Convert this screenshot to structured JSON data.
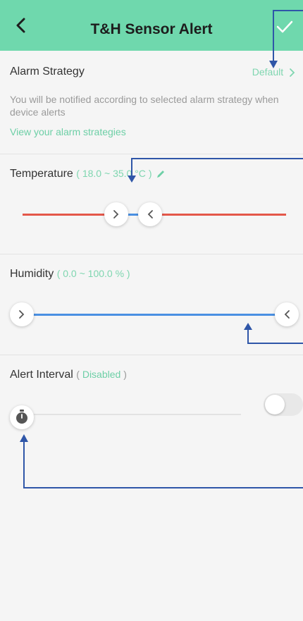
{
  "header": {
    "title": "T&H Sensor Alert",
    "back_icon": "chevron-left-icon",
    "confirm_icon": "check-icon",
    "background": "#6fd8ad"
  },
  "alarm_strategy": {
    "label": "Alarm Strategy",
    "value": "Default",
    "description": "You will be notified according to selected alarm strategy when device alerts",
    "link_text": "View your alarm strategies"
  },
  "temperature": {
    "label": "Temperature",
    "range_open": "(",
    "min": "18.0",
    "separator": "~",
    "max": "35.0",
    "unit": "°C",
    "range_close": ")",
    "track_color": "#e4574a",
    "inner_color": "#4a90e2"
  },
  "humidity": {
    "label": "Humidity",
    "range_text": "( 0.0 ~ 100.0 % )",
    "track_color": "#4a90e2"
  },
  "alert_interval": {
    "label": "Alert Interval",
    "range_open": "(",
    "status": "Disabled",
    "range_close": ")",
    "toggle_on": false
  }
}
